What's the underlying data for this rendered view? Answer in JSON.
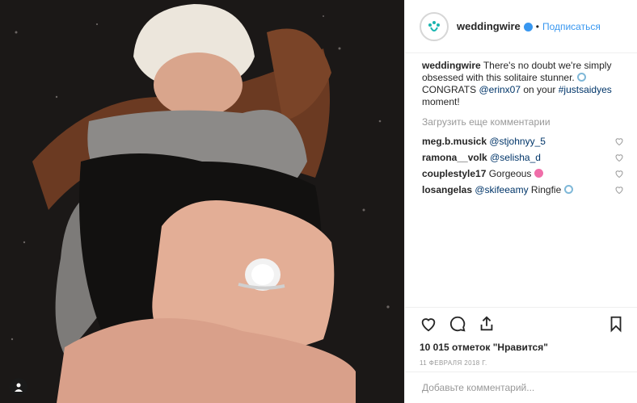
{
  "post": {
    "image_alt": "Engagement ring photo"
  },
  "header": {
    "username": "weddingwire",
    "separator": "•",
    "follow_label": "Подписаться"
  },
  "caption": {
    "username": "weddingwire",
    "text_part1": "There's no doubt we're simply obsessed with this solitaire stunner.",
    "text_part2": "CONGRATS",
    "mention": "@erinx07",
    "text_part3": "on your",
    "hashtag": "#justsaidyes",
    "text_part4": "moment!"
  },
  "load_more_label": "Загрузить еще комментарии",
  "comments": [
    {
      "user": "meg.b.musick",
      "mention": "@stjohnyy_5",
      "text": ""
    },
    {
      "user": "ramona__volk",
      "mention": "@selisha_d",
      "text": ""
    },
    {
      "user": "couplestyle17",
      "mention": "",
      "text": "Gorgeous"
    },
    {
      "user": "losangelas",
      "mention": "@skifeeamy",
      "text": "Ringfie"
    }
  ],
  "likes_text": "10 015 отметок \"Нравится\"",
  "date_text": "11 ФЕВРАЛЯ 2018 Г.",
  "add_comment_placeholder": "Добавьте комментарий...",
  "colors": {
    "accent": "#3897f0",
    "link": "#003569",
    "muted": "#999999"
  }
}
